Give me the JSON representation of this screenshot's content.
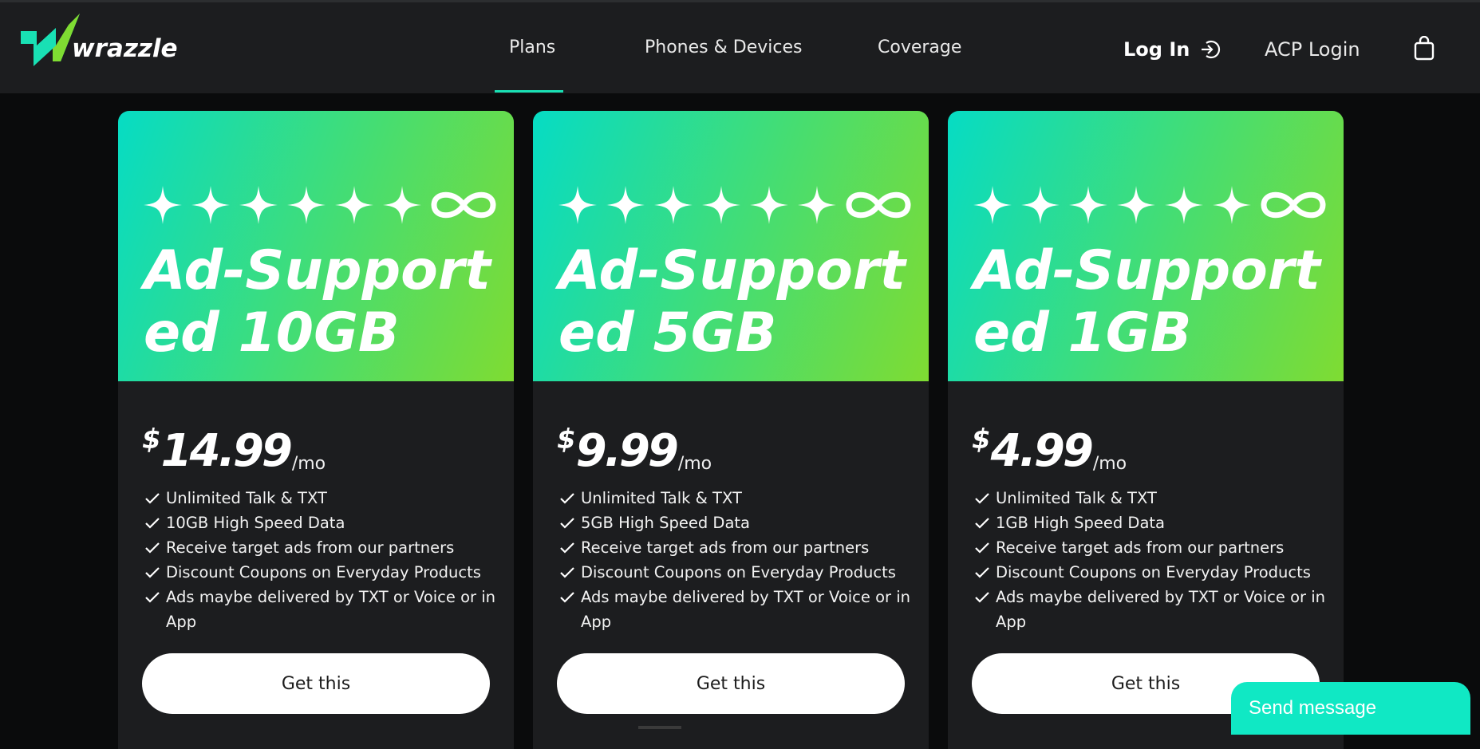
{
  "header": {
    "logo_text": "wrazzle",
    "nav": [
      {
        "label": "Plans",
        "active": true
      },
      {
        "label": "Phones & Devices"
      },
      {
        "label": "Coverage"
      }
    ],
    "login_label": "Log In",
    "acp_label": "ACP Login"
  },
  "colors": {
    "accent": "#19e0b4",
    "gradient_start": "#06dcc4",
    "gradient_end": "#7fdc32",
    "card_bg": "#1c1d1f",
    "page_bg": "#0a0b0c"
  },
  "plans": [
    {
      "name": "Ad-Supported 10GB",
      "price_symbol": "$",
      "price": "14.99",
      "price_unit": "/mo",
      "features": [
        "Unlimited Talk & TXT",
        "10GB High Speed Data",
        "Receive target ads from our partners",
        "Discount Coupons on Everyday Products",
        "Ads maybe delivered by TXT or Voice or in App"
      ],
      "cta": "Get this"
    },
    {
      "name": "Ad-Supported 5GB",
      "price_symbol": "$",
      "price": "9.99",
      "price_unit": "/mo",
      "features": [
        "Unlimited Talk & TXT",
        "5GB High Speed Data",
        "Receive target ads from our partners",
        "Discount Coupons on Everyday Products",
        "Ads maybe delivered by TXT or Voice or in App"
      ],
      "cta": "Get this"
    },
    {
      "name": "Ad-Supported 1GB",
      "price_symbol": "$",
      "price": "4.99",
      "price_unit": "/mo",
      "features": [
        "Unlimited Talk & TXT",
        "1GB High Speed Data",
        "Receive target ads from our partners",
        "Discount Coupons on Everyday Products",
        "Ads maybe delivered by TXT or Voice or in App"
      ],
      "cta": "Get this"
    }
  ],
  "chat": {
    "label": "Send message"
  },
  "icons": {
    "logo": "lightning-logo-icon",
    "login": "login-arrow-icon",
    "cart": "shopping-bag-icon",
    "rating": "sparkle-star-icon",
    "unlimited": "infinity-icon",
    "feature": "checkmark-icon"
  }
}
